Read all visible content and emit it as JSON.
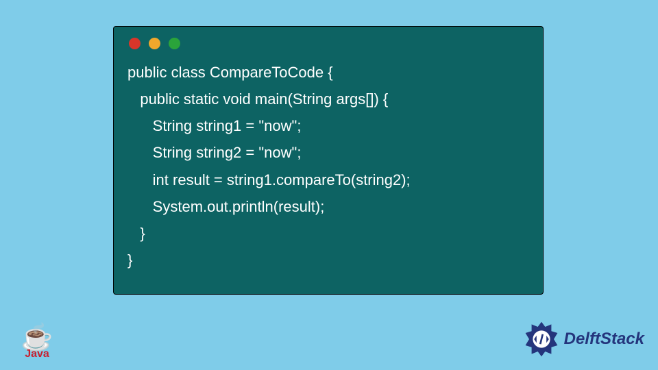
{
  "code": {
    "lines": [
      "public class CompareToCode {",
      "   public static void main(String args[]) {",
      "      String string1 = \"now\";",
      "      String string2 = \"now\";",
      "      int result = string1.compareTo(string2);",
      "      System.out.println(result);",
      "   }",
      "}"
    ]
  },
  "logos": {
    "java_label": "Java",
    "delft_label": "DelftStack"
  },
  "colors": {
    "page_bg": "#7fcce9",
    "window_bg": "#0d6363",
    "code_text": "#ffffff",
    "dot_red": "#d9362a",
    "dot_yellow": "#f0a72c",
    "dot_green": "#2aa43a",
    "java_red": "#c8202f",
    "delft_blue": "#24357c"
  }
}
